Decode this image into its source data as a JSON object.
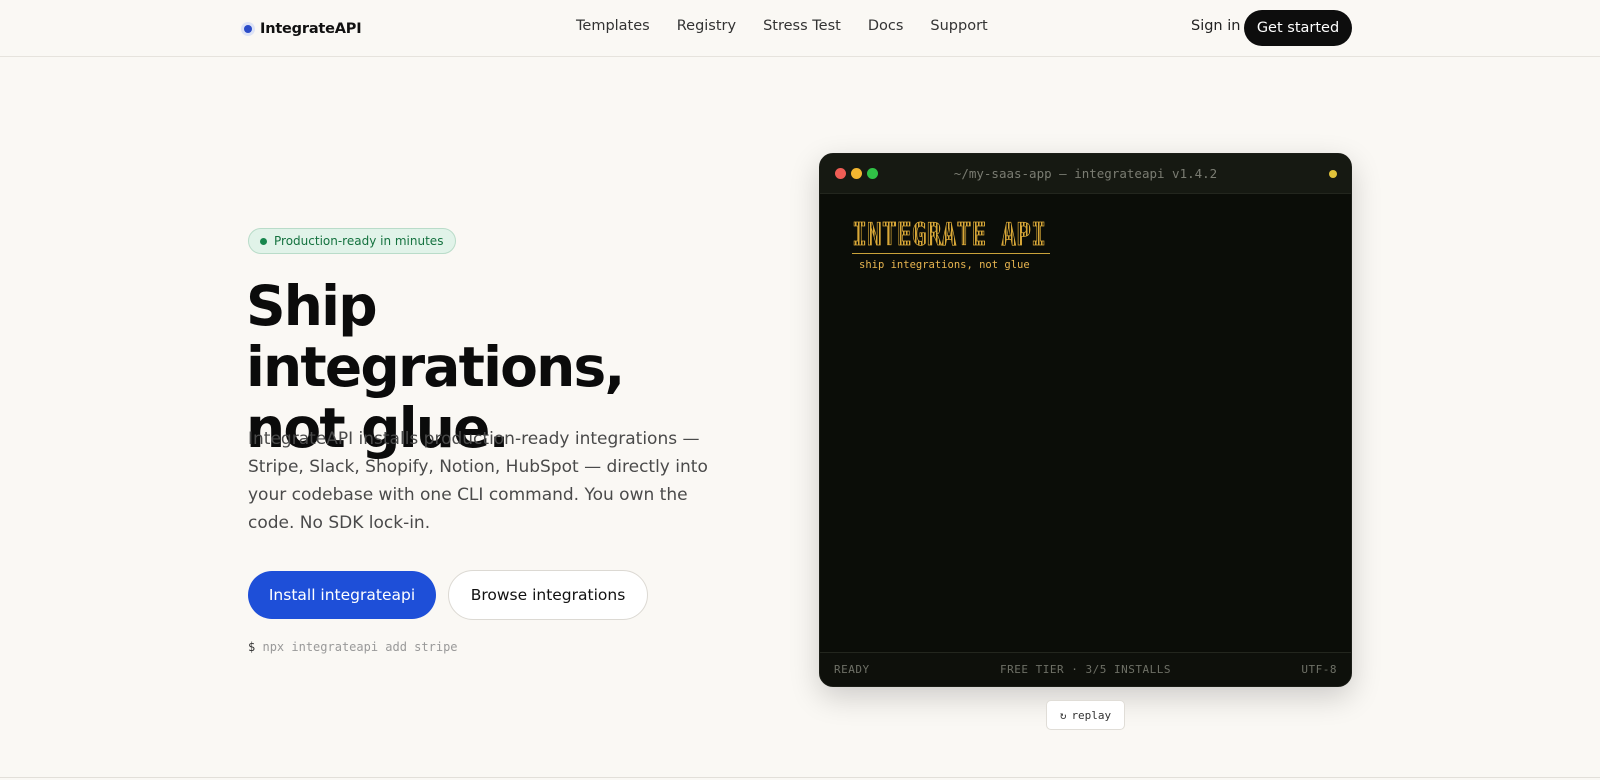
{
  "header": {
    "brand": "IntegrateAPI",
    "nav": [
      "Templates",
      "Registry",
      "Stress Test",
      "Docs",
      "Support"
    ],
    "sign_in": "Sign in",
    "cta": "Get started"
  },
  "hero": {
    "badge": "Production-ready in minutes",
    "headline_line1": "Ship integrations,",
    "headline_line2": "not glue.",
    "lead": "IntegrateAPI installs production-ready integrations — Stripe, Slack, Shopify, Notion, HubSpot — directly into your codebase with one CLI command. You own the code. No SDK lock-in.",
    "primary_button": "Install integrateapi",
    "secondary_button": "Browse integrations",
    "command_prompt": "$",
    "command": "npx integrateapi add stripe"
  },
  "terminal": {
    "title": "~/my-saas-app — integrateapi v1.4.2",
    "ascii_logo": "INTEGRATE API",
    "tagline": "ship integrations, not glue",
    "status_left": "READY",
    "status_center": "FREE TIER · 3/5 INSTALLS",
    "status_right": "UTF-8",
    "replay_icon": "↻",
    "replay_label": "replay"
  },
  "colors": {
    "accent": "#1e4fd8",
    "terminal_bg": "#0b0d08",
    "ascii_gold": "#c9a23a",
    "badge_green": "#14723f"
  }
}
